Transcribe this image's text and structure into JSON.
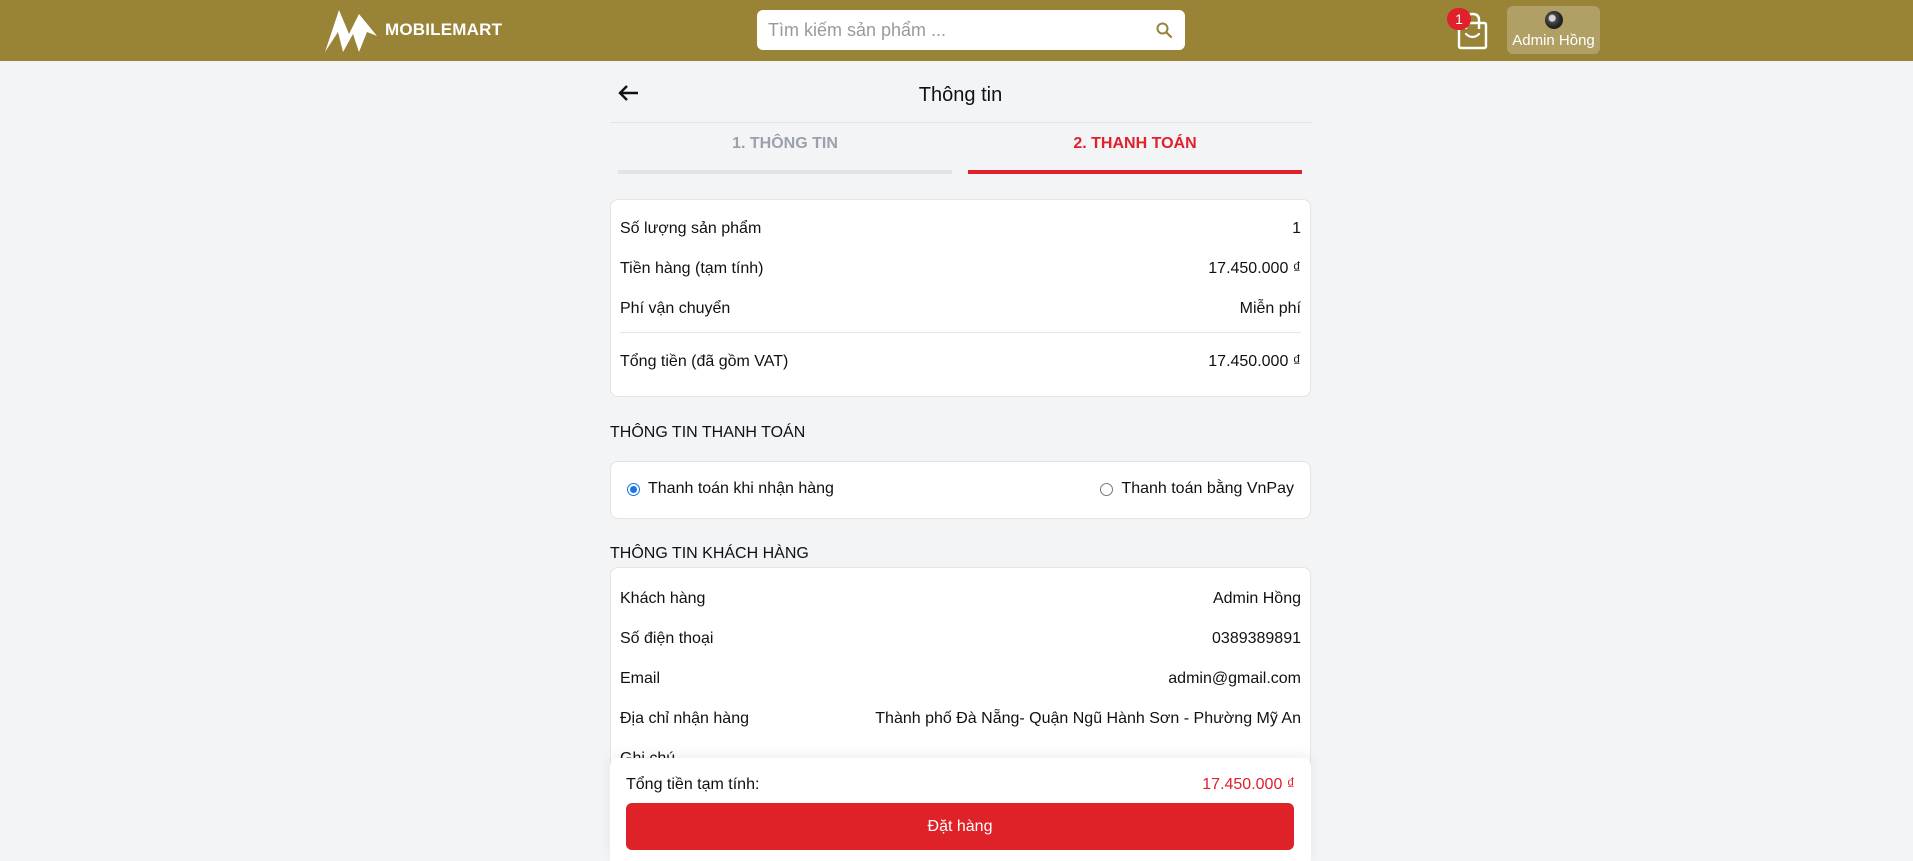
{
  "header": {
    "brand": "MOBILEMART",
    "search_placeholder": "Tìm kiếm sản phẩm ...",
    "search_value": "",
    "cart_count": "1",
    "user_name": "Admin Hồng"
  },
  "page": {
    "title": "Thông tin",
    "tabs": [
      {
        "label": "1. THÔNG TIN",
        "active": false
      },
      {
        "label": "2. THANH TOÁN",
        "active": true
      }
    ]
  },
  "summary": {
    "rows": [
      {
        "label": "Số lượng sản phẩm",
        "value": "1"
      },
      {
        "label": "Tiền hàng (tạm tính)",
        "value": "17.450.000 ₫"
      },
      {
        "label": "Phí vận chuyển",
        "value": "Miễn phí"
      }
    ],
    "total": {
      "label": "Tổng tiền (đã gồm VAT)",
      "value": "17.450.000 ₫"
    }
  },
  "payment": {
    "title": "THÔNG TIN THANH TOÁN",
    "options": [
      {
        "label": "Thanh toán khi nhận hàng",
        "checked": true
      },
      {
        "label": "Thanh toán bằng VnPay",
        "checked": false
      }
    ]
  },
  "customer": {
    "title": "THÔNG TIN KHÁCH HÀNG",
    "rows": [
      {
        "label": "Khách hàng",
        "value": "Admin Hồng"
      },
      {
        "label": "Số điện thoại",
        "value": "0389389891"
      },
      {
        "label": "Email",
        "value": "admin@gmail.com"
      },
      {
        "label": "Địa chỉ nhận hàng",
        "value": "Thành phố Đà Nẵng- Quận Ngũ Hành Sơn - Phường Mỹ An"
      },
      {
        "label": "Ghi chú",
        "value": ""
      }
    ]
  },
  "bottom": {
    "subtotal_label": "Tổng tiền tạm tính:",
    "subtotal_value": "17.450.000 ₫",
    "order_button": "Đặt hàng"
  },
  "colors": {
    "header_bg": "#988337",
    "accent_red": "#e0202b",
    "radio_blue": "#1a73e8"
  }
}
